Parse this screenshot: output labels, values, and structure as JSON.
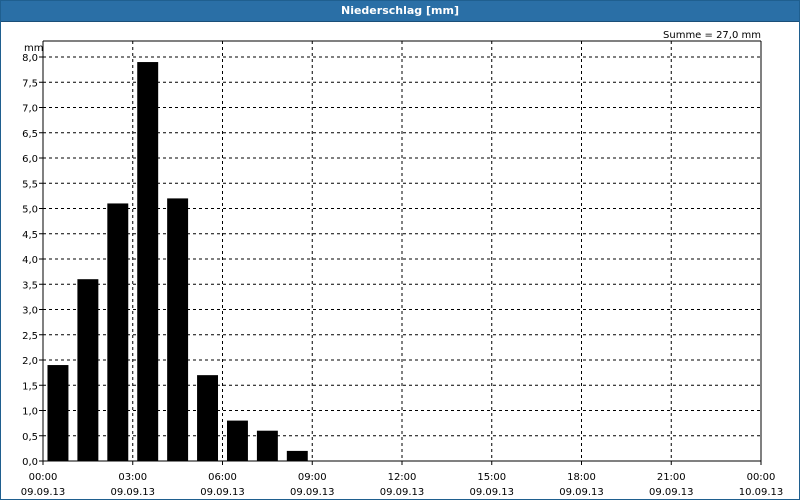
{
  "window": {
    "title": "Niederschlag [mm]"
  },
  "chart_data": {
    "type": "bar",
    "title": "Niederschlag [mm]",
    "ylabel": "mm",
    "annotation": "Summe = 27,0 mm",
    "ylim": [
      0,
      8
    ],
    "y_step": 0.5,
    "y_ticks": [
      "0,0",
      "0,5",
      "1,0",
      "1,5",
      "2,0",
      "2,5",
      "3,0",
      "3,5",
      "4,0",
      "4,5",
      "5,0",
      "5,5",
      "6,0",
      "6,5",
      "7,0",
      "7,5",
      "8,0"
    ],
    "x_range_hours": [
      0,
      24
    ],
    "x_ticks": [
      {
        "time": "00:00",
        "date": "09.09.13"
      },
      {
        "time": "03:00",
        "date": "09.09.13"
      },
      {
        "time": "06:00",
        "date": "09.09.13"
      },
      {
        "time": "09:00",
        "date": "09.09.13"
      },
      {
        "time": "12:00",
        "date": "09.09.13"
      },
      {
        "time": "15:00",
        "date": "09.09.13"
      },
      {
        "time": "18:00",
        "date": "09.09.13"
      },
      {
        "time": "21:00",
        "date": "09.09.13"
      },
      {
        "time": "00:00",
        "date": "10.09.13"
      }
    ],
    "categories": [
      "00:00",
      "01:00",
      "02:00",
      "03:00",
      "04:00",
      "05:00",
      "06:00",
      "07:00",
      "08:00"
    ],
    "values": [
      1.9,
      3.6,
      5.1,
      7.9,
      5.2,
      1.7,
      0.8,
      0.6,
      0.2
    ],
    "grid": true,
    "bar_color": "#000000",
    "grid_color": "#000000"
  }
}
